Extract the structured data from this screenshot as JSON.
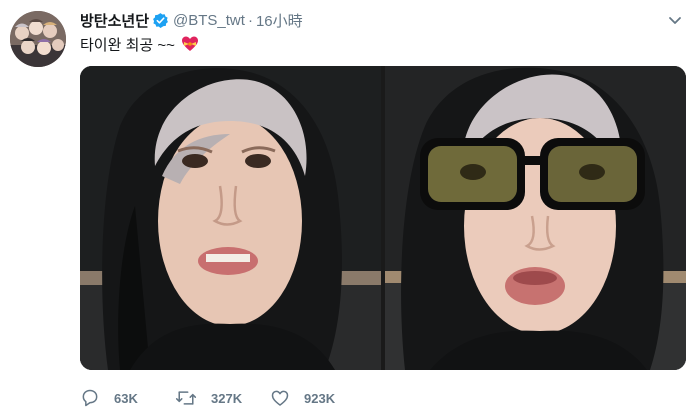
{
  "user": {
    "display_name": "방탄소년단",
    "handle": "@BTS_twt",
    "separator": "·",
    "time": "16小時",
    "verified": true
  },
  "tweet": {
    "text": "타이완 최공 ~~",
    "emoji": "heart-with-ribbon"
  },
  "media": {
    "photos": [
      {
        "description": "selfie-hood"
      },
      {
        "description": "selfie-hood-sunglasses"
      }
    ]
  },
  "actions": {
    "reply_count": "63K",
    "retweet_count": "327K",
    "like_count": "923K"
  },
  "colors": {
    "text": "#14171a",
    "secondary": "#657786",
    "verified": "#1da1f2"
  }
}
